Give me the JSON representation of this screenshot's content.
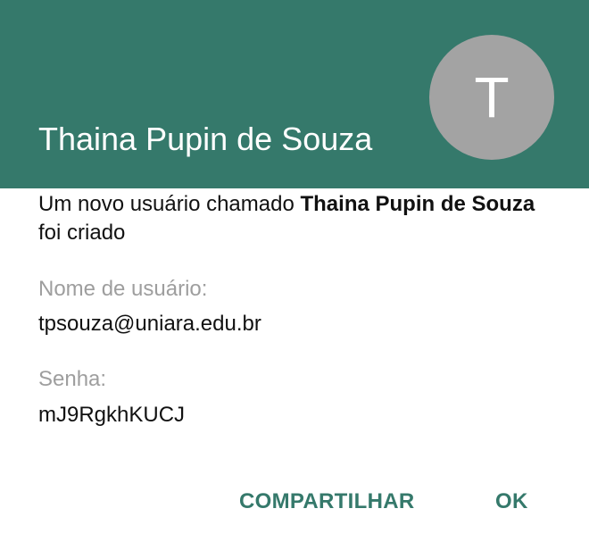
{
  "header": {
    "title": "Thaina Pupin de Souza",
    "avatar_letter": "T"
  },
  "message": {
    "prefix": "Um novo usuário chamado ",
    "name": "Thaina Pupin de Souza",
    "suffix": " foi criado"
  },
  "fields": {
    "username_label": "Nome de usuário:",
    "username_value": "tpsouza@uniara.edu.br",
    "password_label": "Senha:",
    "password_value": "mJ9RgkhKUCJ"
  },
  "actions": {
    "share_label": "COMPARTILHAR",
    "ok_label": "OK"
  },
  "colors": {
    "header_bg": "#35796b",
    "avatar_bg": "#a3a3a3",
    "accent": "#35796b"
  }
}
